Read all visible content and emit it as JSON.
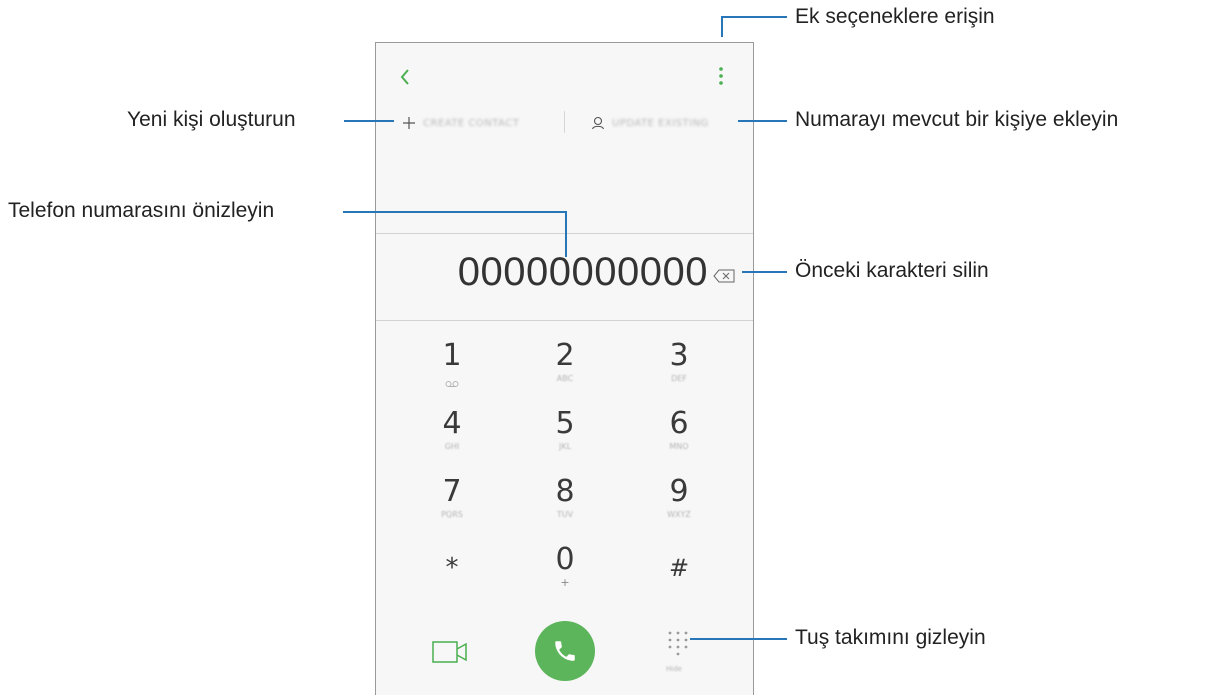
{
  "screen": {
    "phone_number": "00000000000",
    "actions": {
      "create_contact": "CREATE CONTACT",
      "update_existing": "UPDATE EXISTING"
    },
    "keys": [
      {
        "digit": "1",
        "sub": ""
      },
      {
        "digit": "2",
        "sub": "ABC"
      },
      {
        "digit": "3",
        "sub": "DEF"
      },
      {
        "digit": "4",
        "sub": "GHI"
      },
      {
        "digit": "5",
        "sub": "JKL"
      },
      {
        "digit": "6",
        "sub": "MNO"
      },
      {
        "digit": "7",
        "sub": "PQRS"
      },
      {
        "digit": "8",
        "sub": "TUV"
      },
      {
        "digit": "9",
        "sub": "WXYZ"
      },
      {
        "digit": "*",
        "sub": ""
      },
      {
        "digit": "0",
        "sub": "+"
      },
      {
        "digit": "#",
        "sub": ""
      }
    ],
    "hide_label": "Hide",
    "colors": {
      "accent_green": "#4caf50",
      "call_button": "#5cb55b",
      "callout_line": "#2676b8"
    }
  },
  "callouts": {
    "more_options": "Ek seçeneklere erişin",
    "create_contact": "Yeni kişi oluşturun",
    "add_to_existing": "Numarayı mevcut bir kişiye ekleyin",
    "preview_number": "Telefon numarasını önizleyin",
    "delete_char": "Önceki karakteri silin",
    "hide_keypad": "Tuş takımını gizleyin"
  }
}
